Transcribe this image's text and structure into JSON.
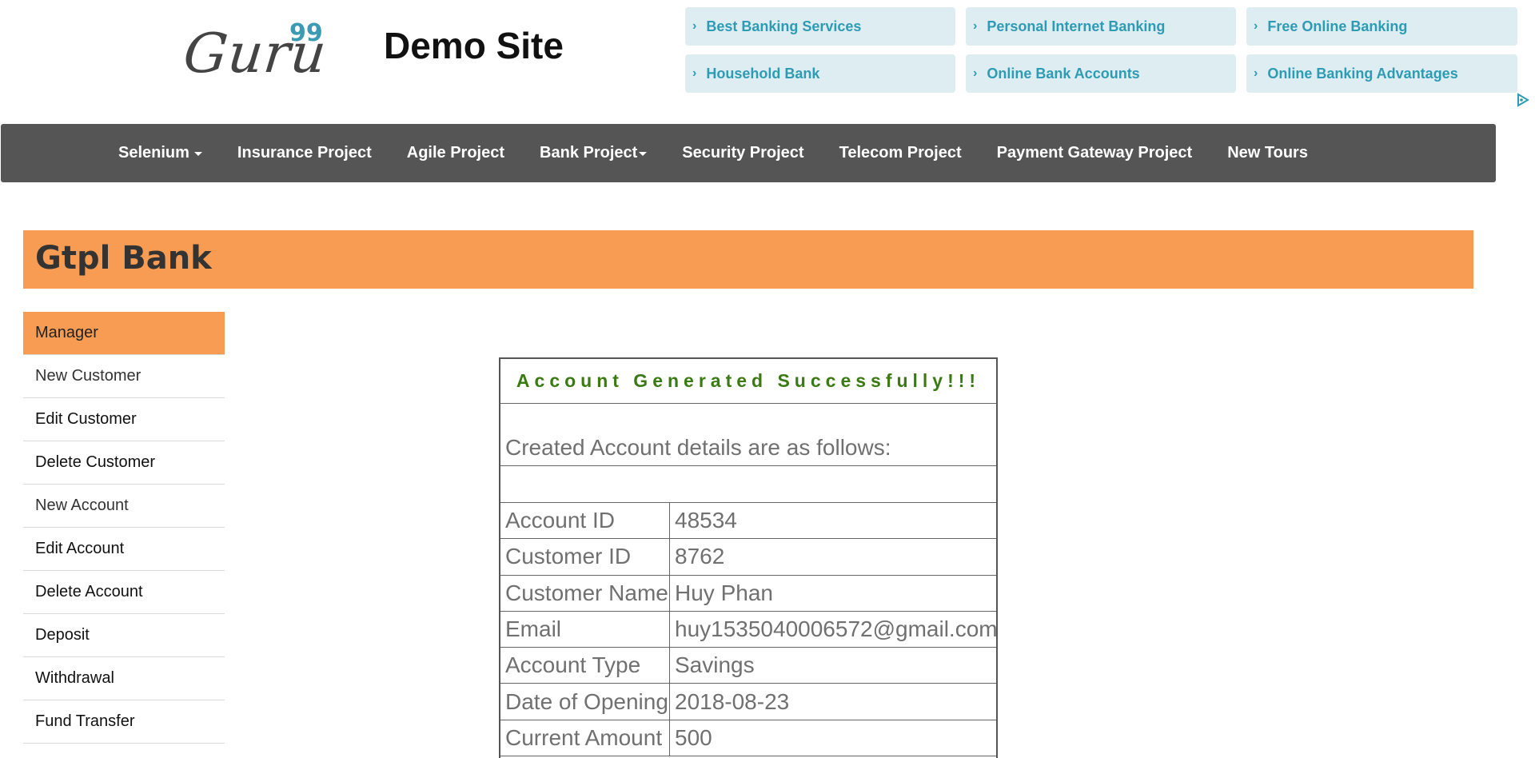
{
  "header": {
    "logo_text": "Guru",
    "logo_sup": "99",
    "site_title": "Demo Site"
  },
  "ads": [
    {
      "label": "Best Banking Services"
    },
    {
      "label": "Personal Internet Banking"
    },
    {
      "label": "Free Online Banking"
    },
    {
      "label": "Household Bank"
    },
    {
      "label": "Online Bank Accounts"
    },
    {
      "label": "Online Banking Advantages"
    }
  ],
  "ad_chevron": "›",
  "nav": [
    {
      "label": "Selenium"
    },
    {
      "label": "Insurance Project"
    },
    {
      "label": "Agile Project"
    },
    {
      "label": "Bank Project"
    },
    {
      "label": "Security Project"
    },
    {
      "label": "Telecom Project"
    },
    {
      "label": "Payment Gateway Project"
    },
    {
      "label": "New Tours"
    }
  ],
  "bank": {
    "title": "Gtpl Bank"
  },
  "sidebar": [
    {
      "label": "Manager"
    },
    {
      "label": "New Customer"
    },
    {
      "label": "Edit Customer"
    },
    {
      "label": "Delete Customer"
    },
    {
      "label": "New Account"
    },
    {
      "label": "Edit Account"
    },
    {
      "label": "Delete Account"
    },
    {
      "label": "Deposit"
    },
    {
      "label": "Withdrawal"
    },
    {
      "label": "Fund Transfer"
    }
  ],
  "result": {
    "heading": "Account Generated Successfully!!!",
    "intro": "Created Account details are as follows:",
    "rows": [
      {
        "label": "Account ID",
        "value": "48534"
      },
      {
        "label": "Customer ID",
        "value": "8762"
      },
      {
        "label": "Customer Name",
        "value": "Huy Phan"
      },
      {
        "label": "Email",
        "value": "huy1535040006572@gmail.com"
      },
      {
        "label": "Account Type",
        "value": "Savings"
      },
      {
        "label": "Date of Opening",
        "value": "2018-08-23"
      },
      {
        "label": "Current Amount",
        "value": "500"
      }
    ]
  },
  "colors": {
    "navbar": "#555555",
    "accent_orange": "#f79c52",
    "ad_background": "#ddedf2",
    "ad_text": "#2e9bb4",
    "success_green": "#3a7a12"
  },
  "icons": {
    "adchoices": "adchoices-icon",
    "dropdown": "caret-down-icon"
  }
}
